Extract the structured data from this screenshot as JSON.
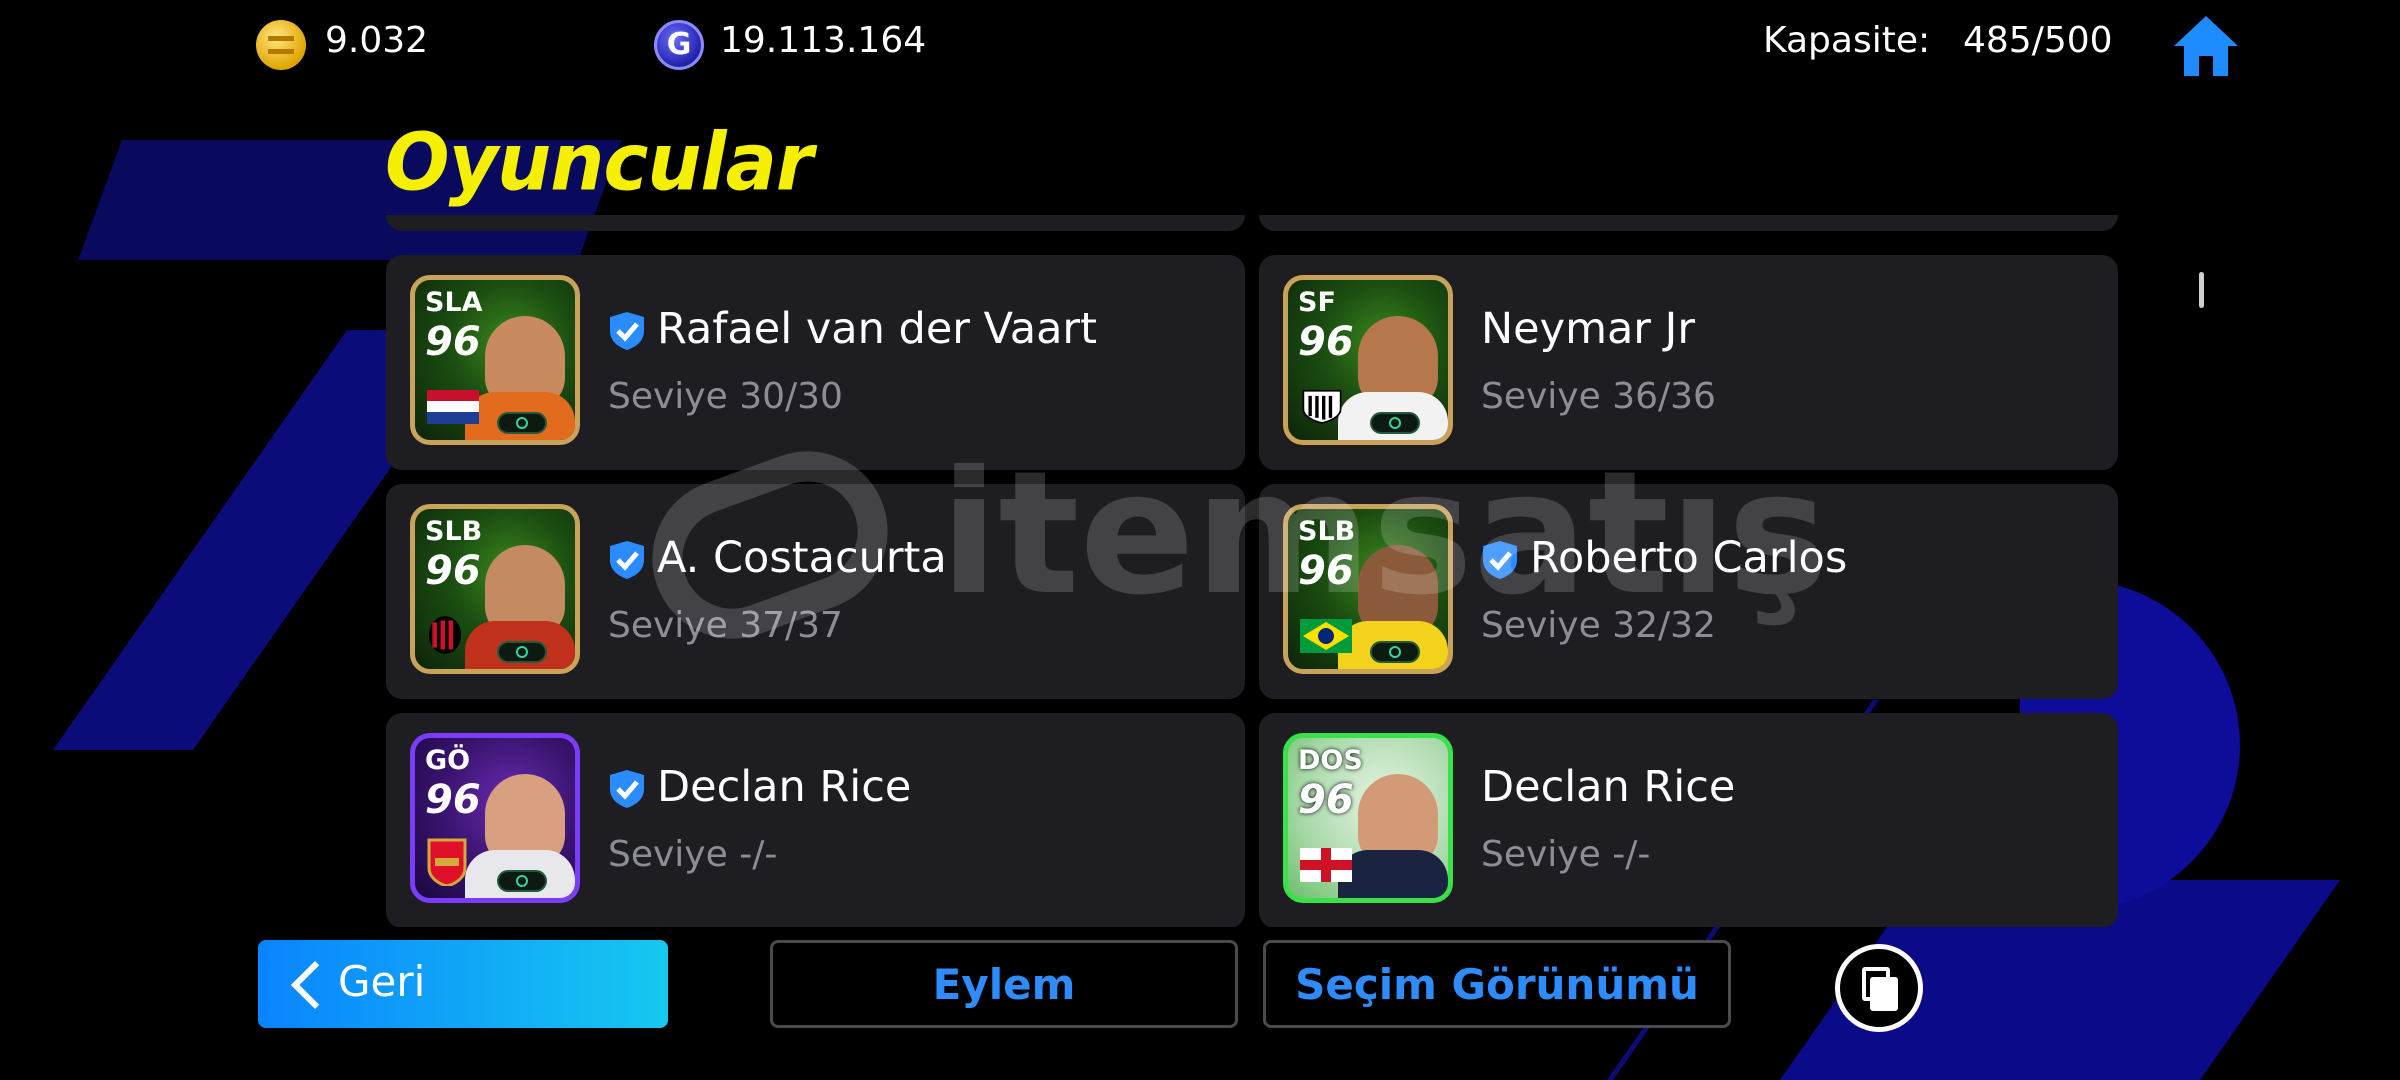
{
  "topbar": {
    "gp_icon": "gold-coin-icon",
    "gp_value": "9.032",
    "g_icon": "g-coin-icon",
    "g_letter": "G",
    "g_value": "19.113.164",
    "capacity_label": "Kapasite:",
    "capacity_value": "485/500",
    "home_icon": "home-icon"
  },
  "page_title": "Oyuncular",
  "players": [
    {
      "position": "SLA",
      "rating": "96",
      "name": "Rafael van der Vaart",
      "verified": true,
      "level": "Seviye 30/30",
      "card_style": "gold",
      "flag": "netherlands"
    },
    {
      "position": "SF",
      "rating": "96",
      "name": "Neymar Jr",
      "verified": false,
      "level": "Seviye 36/36",
      "card_style": "gold",
      "flag": "santos-crest"
    },
    {
      "position": "SLB",
      "rating": "96",
      "name": "A. Costacurta",
      "verified": true,
      "level": "Seviye 37/37",
      "card_style": "gold",
      "flag": "milan-crest"
    },
    {
      "position": "SLB",
      "rating": "96",
      "name": "Roberto Carlos",
      "verified": true,
      "level": "Seviye 32/32",
      "card_style": "gold",
      "flag": "brazil"
    },
    {
      "position": "GÖ",
      "rating": "96",
      "name": "Declan Rice",
      "verified": true,
      "level": "Seviye -/-",
      "card_style": "purple",
      "flag": "arsenal-crest"
    },
    {
      "position": "DOS",
      "rating": "96",
      "name": "Declan Rice",
      "verified": false,
      "level": "Seviye -/-",
      "card_style": "green",
      "flag": "england"
    }
  ],
  "bottombar": {
    "back_label": "Geri",
    "action_label": "Eylem",
    "selection_view_label": "Seçim Görünümü",
    "copy_icon": "copy-icon"
  },
  "colors": {
    "title": "#f5f000",
    "accent": "#2f8cff",
    "card_bg": "#1d1d22",
    "level_text": "#8d8d96"
  },
  "watermark": "itemsatış"
}
